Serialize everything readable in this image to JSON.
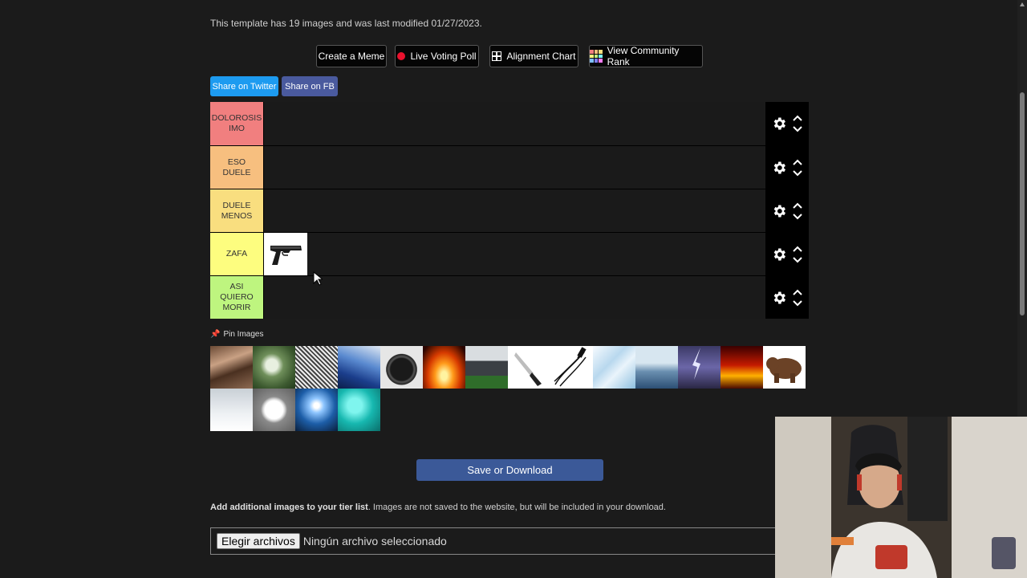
{
  "info": "This template has 19 images and was last modified 01/27/2023.",
  "buttons": {
    "create_meme": "Create a Meme",
    "live_poll": "Live Voting Poll",
    "alignment": "Alignment Chart",
    "community": "View Community Rank"
  },
  "share": {
    "twitter": "Share on Twitter",
    "fb": "Share on FB"
  },
  "tiers": [
    {
      "label": "DOLOROSIS IMO",
      "color": "#f17f7f"
    },
    {
      "label": "ESO DUELE",
      "color": "#f7bf7f"
    },
    {
      "label": "DUELE MENOS",
      "color": "#f9de7f"
    },
    {
      "label": "ZAFA",
      "color": "#fdfd7f"
    },
    {
      "label": "ASI QUIERO MORIR",
      "color": "#bef57f"
    }
  ],
  "pin_label": "Pin Images",
  "save_label": "Save or Download",
  "add_images": {
    "bold": "Add additional images to your tier list",
    "rest": ". Images are not saved to the website, but will be included in your download."
  },
  "file_input": {
    "button": "Elegir archivos",
    "status": "Ningún archivo seleccionado"
  },
  "colors": {
    "background": "#1b1b1b",
    "save_button": "#3b5998",
    "twitter": "#1d9bf0",
    "fb": "#4a5a9e"
  }
}
